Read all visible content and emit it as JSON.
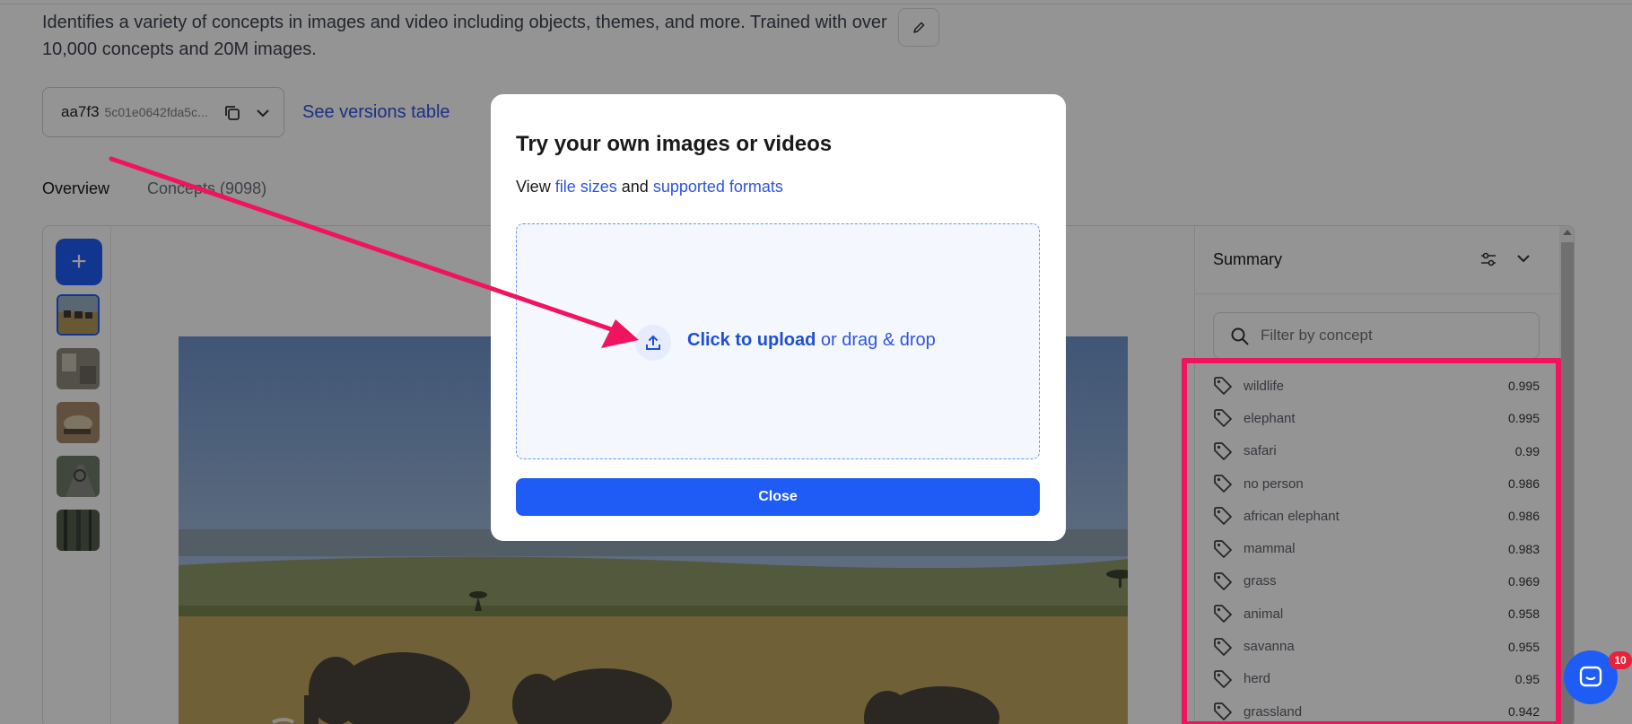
{
  "header": {
    "description": "Identifies a variety of concepts in images and video including objects, themes, and more. Trained with over 10,000 concepts and 20M images.",
    "edit_icon": "pencil-icon"
  },
  "version": {
    "id": "aa7f3",
    "hash": "5c01e0642fda5c...",
    "copy_icon": "copy-icon",
    "dropdown_icon": "chevron-down-icon",
    "versions_link": "See versions table"
  },
  "tabs": [
    {
      "label": "Overview"
    },
    {
      "label": "Concepts (9098)"
    }
  ],
  "sidebar": {
    "add_label": "+"
  },
  "summary": {
    "title": "Summary",
    "filter_placeholder": "Filter by concept",
    "concepts": [
      {
        "name": "wildlife",
        "score": "0.995"
      },
      {
        "name": "elephant",
        "score": "0.995"
      },
      {
        "name": "safari",
        "score": "0.99"
      },
      {
        "name": "no person",
        "score": "0.986"
      },
      {
        "name": "african elephant",
        "score": "0.986"
      },
      {
        "name": "mammal",
        "score": "0.983"
      },
      {
        "name": "grass",
        "score": "0.969"
      },
      {
        "name": "animal",
        "score": "0.958"
      },
      {
        "name": "savanna",
        "score": "0.955"
      },
      {
        "name": "herd",
        "score": "0.95"
      },
      {
        "name": "grassland",
        "score": "0.942"
      }
    ]
  },
  "modal": {
    "title": "Try your own images or videos",
    "sub_prefix": "View",
    "sub_link1": "file sizes",
    "sub_and": "and",
    "sub_link2": "supported formats",
    "upload_strong": "Click to upload",
    "upload_rest": "or drag & drop",
    "close_label": "Close"
  },
  "chat": {
    "badge": "10"
  },
  "colors": {
    "accent": "#1f5cf6",
    "link": "#2f54e0",
    "highlight": "#f0145f"
  }
}
